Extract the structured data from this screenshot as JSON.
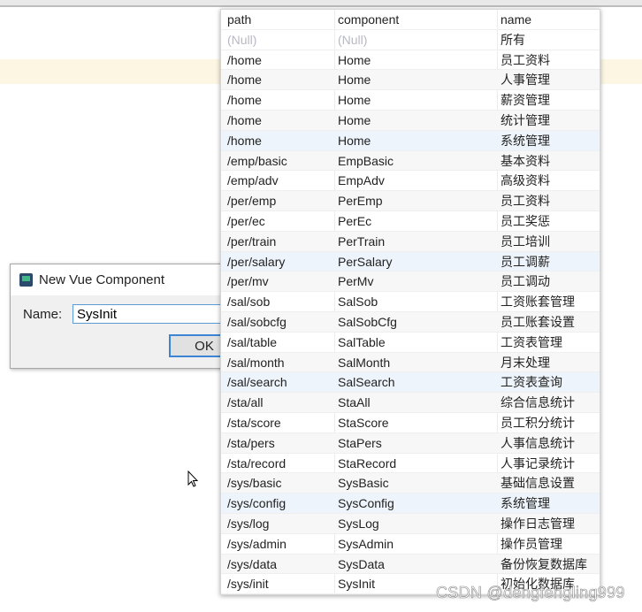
{
  "dialog": {
    "title": "New Vue Component",
    "name_label": "Name:",
    "name_value": "SysInit",
    "ok_label": "OK"
  },
  "table": {
    "headers": [
      "path",
      "component",
      "name"
    ],
    "rows": [
      [
        "(Null)",
        "(Null)",
        "所有"
      ],
      [
        "/home",
        "Home",
        "员工资料"
      ],
      [
        "/home",
        "Home",
        "人事管理"
      ],
      [
        "/home",
        "Home",
        "薪资管理"
      ],
      [
        "/home",
        "Home",
        "统计管理"
      ],
      [
        "/home",
        "Home",
        "系统管理"
      ],
      [
        "/emp/basic",
        "EmpBasic",
        "基本资料"
      ],
      [
        "/emp/adv",
        "EmpAdv",
        "高级资料"
      ],
      [
        "/per/emp",
        "PerEmp",
        "员工资料"
      ],
      [
        "/per/ec",
        "PerEc",
        "员工奖惩"
      ],
      [
        "/per/train",
        "PerTrain",
        "员工培训"
      ],
      [
        "/per/salary",
        "PerSalary",
        "员工调薪"
      ],
      [
        "/per/mv",
        "PerMv",
        "员工调动"
      ],
      [
        "/sal/sob",
        "SalSob",
        "工资账套管理"
      ],
      [
        "/sal/sobcfg",
        "SalSobCfg",
        "员工账套设置"
      ],
      [
        "/sal/table",
        "SalTable",
        "工资表管理"
      ],
      [
        "/sal/month",
        "SalMonth",
        "月末处理"
      ],
      [
        "/sal/search",
        "SalSearch",
        "工资表查询"
      ],
      [
        "/sta/all",
        "StaAll",
        "综合信息统计"
      ],
      [
        "/sta/score",
        "StaScore",
        "员工积分统计"
      ],
      [
        "/sta/pers",
        "StaPers",
        "人事信息统计"
      ],
      [
        "/sta/record",
        "StaRecord",
        "人事记录统计"
      ],
      [
        "/sys/basic",
        "SysBasic",
        "基础信息设置"
      ],
      [
        "/sys/config",
        "SysConfig",
        "系统管理"
      ],
      [
        "/sys/log",
        "SysLog",
        "操作日志管理"
      ],
      [
        "/sys/admin",
        "SysAdmin",
        "操作员管理"
      ],
      [
        "/sys/data",
        "SysData",
        "备份恢复数据库"
      ],
      [
        "/sys/init",
        "SysInit",
        "初始化数据库"
      ]
    ],
    "highlighted_rows": [
      5,
      11,
      17,
      23
    ]
  },
  "watermark": "CSDN @dengfengling999"
}
